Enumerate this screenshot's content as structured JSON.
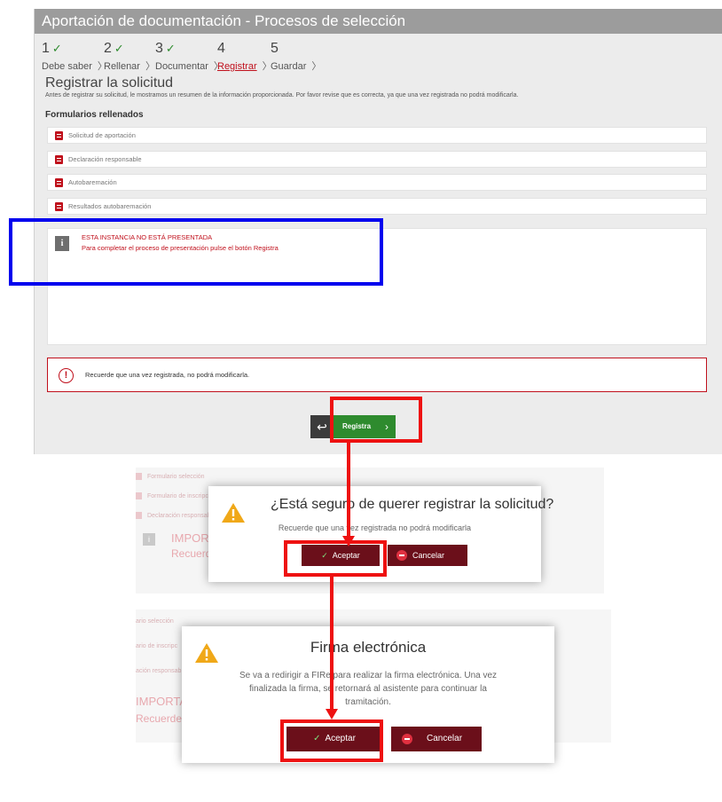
{
  "main": {
    "title": "Aportación de documentación - Procesos de selección",
    "steps": [
      {
        "num": "1",
        "label": "Debe saber",
        "done": true
      },
      {
        "num": "2",
        "label": "Rellenar",
        "done": true
      },
      {
        "num": "3",
        "label": "Documentar",
        "done": true
      },
      {
        "num": "4",
        "label": "Registrar",
        "done": false,
        "active": true
      },
      {
        "num": "5",
        "label": "Guardar",
        "done": false
      }
    ],
    "check_glyph": "✓",
    "chevron_glyph": "〉",
    "page_title": "Registrar la solicitud",
    "page_desc": "Antes de registrar su solicitud, le mostramos un resumen de la información proporcionada. Por favor revise que es correcta, ya que una vez registrada no podrá modificarla.",
    "forms_heading": "Formularios rellenados",
    "forms": [
      "Solicitud de aportación",
      "Declaración responsable",
      "Autobaremación",
      "Resultados autobaremación"
    ],
    "info_glyph": "i",
    "info_title": "ESTA INSTANCIA NO ESTÁ PRESENTADA",
    "info_text": "Para completar el proceso de presentación pulse el botón Registra",
    "warn_glyph": "!",
    "warn_text": "Recuerde que una vez registrada, no podrá modificarla.",
    "back_glyph": "↩",
    "registra_label": "Registra",
    "registra_chevron": "›"
  },
  "dialog1": {
    "bg_rows": [
      "Formulario selección",
      "Formulario de inscripción",
      "Declaración responsable"
    ],
    "bg_important": "IMPORTA",
    "bg_recuerde": "Recuerde",
    "title": "¿Está seguro de querer registrar la solicitud?",
    "text": "Recuerde que una vez registrada no podrá modificarla",
    "accept": "Aceptar",
    "cancel": "Cancelar"
  },
  "dialog2": {
    "bg_rows": [
      "ario selección",
      "ario de inscripc",
      "ación responsab"
    ],
    "bg_important": "IMPORTA",
    "bg_recuerde": "Recuerde",
    "title": "Firma electrónica",
    "text": "Se va a redirigir a FIRe para realizar la firma electrónica. Una vez finalizada la firma, se retornará al asistente para continuar la tramitación.",
    "accept": "Aceptar",
    "cancel": "Cancelar"
  },
  "colors": {
    "accent_red": "#c0101c",
    "button_dark_red": "#6b0f1a",
    "registra_green": "#2e8b2e",
    "annotation_blue": "#0000ee",
    "annotation_red": "#ee1111"
  }
}
